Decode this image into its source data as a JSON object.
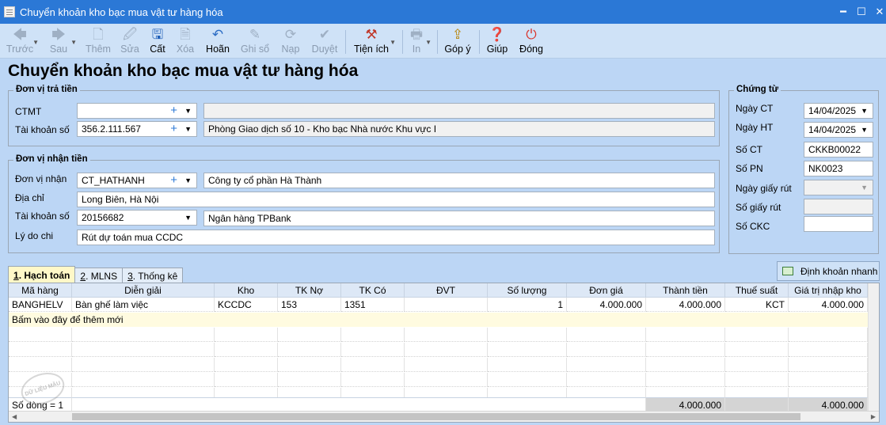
{
  "window": {
    "title": "Chuyển khoản kho bạc mua vật tư hàng hóa",
    "minimize": "━",
    "maximize": "☐",
    "close": "✕"
  },
  "toolbar": {
    "prev": "Trước",
    "next": "Sau",
    "add": "Thêm",
    "edit": "Sửa",
    "save": "Cất",
    "delete": "Xóa",
    "undo": "Hoãn",
    "post": "Ghi sổ",
    "reload": "Nạp",
    "approve": "Duyệt",
    "utilities": "Tiện ích",
    "print": "In",
    "feedback": "Góp ý",
    "help": "Giúp",
    "close": "Đóng"
  },
  "page_title": "Chuyển khoản kho bạc mua vật tư hàng hóa",
  "payer": {
    "title": "Đơn vị trả tiền",
    "ctmt_label": "CTMT",
    "ctmt_value": "",
    "ctmt_desc": "",
    "account_label": "Tài khoản số",
    "account_value": "356.2.111.567",
    "account_desc": "Phòng Giao dịch số 10 - Kho bạc Nhà nước Khu vực I"
  },
  "payee": {
    "title": "Đơn vị nhận tiền",
    "unit_label": "Đơn vị nhận",
    "unit_value": "CT_HATHANH",
    "unit_desc": "Công ty cổ phần Hà Thành",
    "address_label": "Địa chỉ",
    "address_value": "Long Biên, Hà Nội",
    "account_label": "Tài khoản số",
    "account_value": "20156682",
    "bank_name": "Ngân hàng TPBank",
    "reason_label": "Lý do chi",
    "reason_value": "Rút dự toán mua CCDC"
  },
  "voucher": {
    "title": "Chứng từ",
    "date_ct_label": "Ngày CT",
    "date_ct": "14/04/2025",
    "date_ht_label": "Ngày HT",
    "date_ht": "14/04/2025",
    "so_ct_label": "Số CT",
    "so_ct": "CKKB00022",
    "so_pn_label": "Số PN",
    "so_pn": "NK0023",
    "withdraw_date_label": "Ngày giấy rút",
    "withdraw_date": "",
    "withdraw_no_label": "Số giấy rút",
    "withdraw_no": "",
    "ckc_label": "Số CKC",
    "ckc": ""
  },
  "quick_account_button": "Định khoản nhanh",
  "tabs": [
    {
      "num": "1",
      "label": ". Hạch toán"
    },
    {
      "num": "2",
      "label": ". MLNS"
    },
    {
      "num": "3",
      "label": ". Thống kê"
    }
  ],
  "grid": {
    "columns": [
      "Mã hàng",
      "Diễn giải",
      "Kho",
      "TK Nợ",
      "TK Có",
      "ĐVT",
      "Số lượng",
      "Đơn giá",
      "Thành tiền",
      "Thuế suất",
      "Giá trị nhập kho"
    ],
    "rows": [
      [
        "BANGHELV",
        "Bàn ghế làm việc",
        "KCCDC",
        "153",
        "1351",
        "",
        "1",
        "4.000.000",
        "4.000.000",
        "KCT",
        "4.000.000"
      ]
    ],
    "add_row_text": "Bấm vào đây để thêm mới",
    "footer_count": "Số dòng = 1",
    "footer_total_amount": "4.000.000",
    "footer_total_stock": "4.000.000"
  },
  "watermark_text": "DỮ LIỆU MẪU"
}
